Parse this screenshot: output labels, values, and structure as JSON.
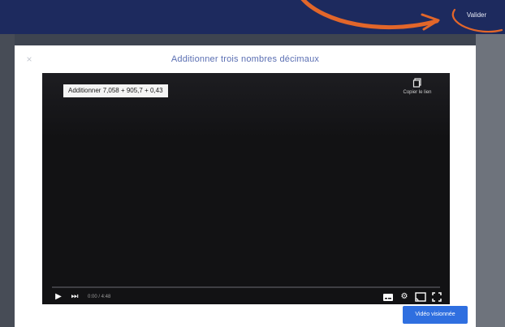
{
  "topbar": {
    "button_label": "Valider"
  },
  "modal": {
    "title": "Additionner trois nombres décimaux",
    "close_symbol": "×",
    "primary_button": "Vidéo visionnée"
  },
  "player": {
    "caption": "Additionner 7,058 + 905,7 + 0,43",
    "copy_link_label": "Copier le lien",
    "time": "0:00 / 4:48",
    "progress": 0
  },
  "colors": {
    "header": "#1d2a5e",
    "annotation": "#e2662a",
    "accent": "#2f6fe0",
    "title_text": "#5b6fb3"
  },
  "icons": [
    "close-icon",
    "copy-link-icon",
    "play-icon",
    "next-icon",
    "subtitles-icon",
    "settings-icon",
    "cast-icon",
    "fullscreen-icon"
  ]
}
